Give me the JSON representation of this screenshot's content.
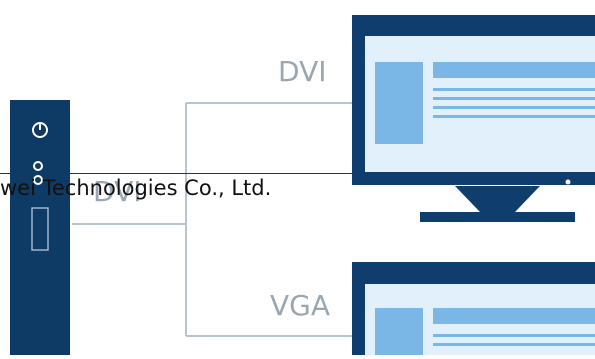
{
  "labels": {
    "dvi_top": "DVI",
    "dvi_left": "DVI",
    "vga": "VGA"
  },
  "footer": {
    "text": "wei Technologies Co., Ltd."
  },
  "colors": {
    "device_navy": "#0e3a66",
    "monitor_navy": "#0f3d6e",
    "screen_fill": "#e2f0fb",
    "screen_blue": "#7bb7e6",
    "connector_line": "#b8c4cc",
    "label_gray": "#9aa7b0"
  }
}
